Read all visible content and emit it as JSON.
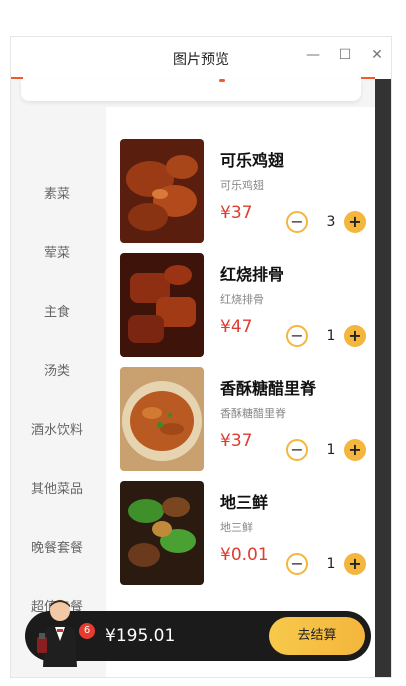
{
  "window": {
    "title": "图片预览",
    "minimize_glyph": "—",
    "maximize_glyph": "☐",
    "close_glyph": "✕"
  },
  "categories": [
    "素菜",
    "荤菜",
    "主食",
    "汤类",
    "酒水饮料",
    "其他菜品",
    "晚餐套餐",
    "超值午餐"
  ],
  "dishes": [
    {
      "name": "可乐鸡翅",
      "sub": "可乐鸡翅",
      "price": "¥37",
      "qty": "3"
    },
    {
      "name": "红烧排骨",
      "sub": "红烧排骨",
      "price": "¥47",
      "qty": "1"
    },
    {
      "name": "香酥糖醋里脊",
      "sub": "香酥糖醋里脊",
      "price": "¥37",
      "qty": "1"
    },
    {
      "name": "地三鲜",
      "sub": "地三鲜",
      "price": "¥0.01",
      "qty": "1"
    }
  ],
  "controls": {
    "minus": "−",
    "plus": "+"
  },
  "cart": {
    "badge": "6",
    "total": "¥195.01",
    "checkout_label": "去结算"
  },
  "colors": {
    "accent": "#f4b63c",
    "price": "#e03c2e",
    "bar": "#1b1b1b",
    "title_line": "#f25a2a"
  }
}
